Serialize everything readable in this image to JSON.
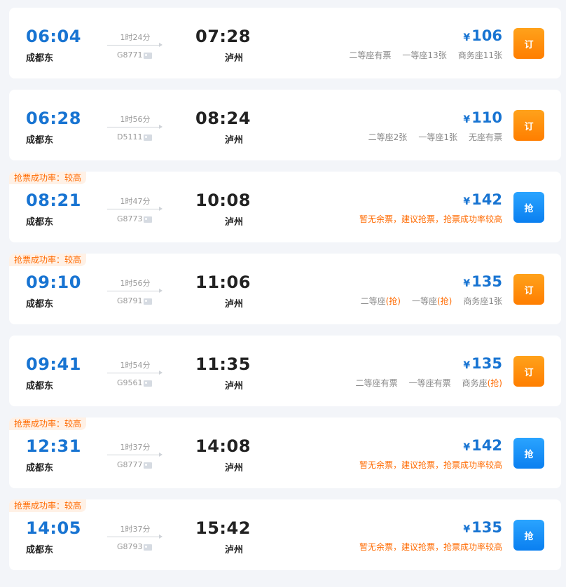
{
  "trains": [
    {
      "badge": "",
      "dep_time": "06:04",
      "dep_station": "成都东",
      "duration": "1时24分",
      "train_no": "G8771",
      "arr_time": "07:28",
      "arr_station": "泸州",
      "price_symbol": "¥",
      "price": "106",
      "warning": "",
      "seats": [
        {
          "name": "二等座",
          "status": "有票",
          "grab": false
        },
        {
          "name": "一等座",
          "status": "13张",
          "grab": false
        },
        {
          "name": "商务座",
          "status": "11张",
          "grab": false
        }
      ],
      "action": "订",
      "action_type": "book"
    },
    {
      "badge": "",
      "dep_time": "06:28",
      "dep_station": "成都东",
      "duration": "1时56分",
      "train_no": "D5111",
      "arr_time": "08:24",
      "arr_station": "泸州",
      "price_symbol": "¥",
      "price": "110",
      "warning": "",
      "seats": [
        {
          "name": "二等座",
          "status": "2张",
          "grab": false
        },
        {
          "name": "一等座",
          "status": "1张",
          "grab": false
        },
        {
          "name": "无座",
          "status": "有票",
          "grab": false
        }
      ],
      "action": "订",
      "action_type": "book"
    },
    {
      "badge": "抢票成功率：较高",
      "dep_time": "08:21",
      "dep_station": "成都东",
      "duration": "1时47分",
      "train_no": "G8773",
      "arr_time": "10:08",
      "arr_station": "泸州",
      "price_symbol": "¥",
      "price": "142",
      "warning": "暂无余票，建议抢票，抢票成功率较高",
      "seats": [],
      "action": "抢",
      "action_type": "grab"
    },
    {
      "badge": "抢票成功率：较高",
      "dep_time": "09:10",
      "dep_station": "成都东",
      "duration": "1时56分",
      "train_no": "G8791",
      "arr_time": "11:06",
      "arr_station": "泸州",
      "price_symbol": "¥",
      "price": "135",
      "warning": "",
      "seats": [
        {
          "name": "二等座",
          "status": "(抢)",
          "grab": true
        },
        {
          "name": "一等座",
          "status": "(抢)",
          "grab": true
        },
        {
          "name": "商务座",
          "status": "1张",
          "grab": false
        }
      ],
      "action": "订",
      "action_type": "book"
    },
    {
      "badge": "",
      "dep_time": "09:41",
      "dep_station": "成都东",
      "duration": "1时54分",
      "train_no": "G9561",
      "arr_time": "11:35",
      "arr_station": "泸州",
      "price_symbol": "¥",
      "price": "135",
      "warning": "",
      "seats": [
        {
          "name": "二等座",
          "status": "有票",
          "grab": false
        },
        {
          "name": "一等座",
          "status": "有票",
          "grab": false
        },
        {
          "name": "商务座",
          "status": "(抢)",
          "grab": true
        }
      ],
      "action": "订",
      "action_type": "book"
    },
    {
      "badge": "抢票成功率：较高",
      "dep_time": "12:31",
      "dep_station": "成都东",
      "duration": "1时37分",
      "train_no": "G8777",
      "arr_time": "14:08",
      "arr_station": "泸州",
      "price_symbol": "¥",
      "price": "142",
      "warning": "暂无余票，建议抢票，抢票成功率较高",
      "seats": [],
      "action": "抢",
      "action_type": "grab"
    },
    {
      "badge": "抢票成功率：较高",
      "dep_time": "14:05",
      "dep_station": "成都东",
      "duration": "1时37分",
      "train_no": "G8793",
      "arr_time": "15:42",
      "arr_station": "泸州",
      "price_symbol": "¥",
      "price": "135",
      "warning": "暂无余票，建议抢票，抢票成功率较高",
      "seats": [],
      "action": "抢",
      "action_type": "grab"
    }
  ],
  "colors": {
    "accent_blue": "#1874d2",
    "accent_orange": "#ff6a00",
    "book_button": "#ff8a00",
    "grab_button": "#1890ff"
  }
}
